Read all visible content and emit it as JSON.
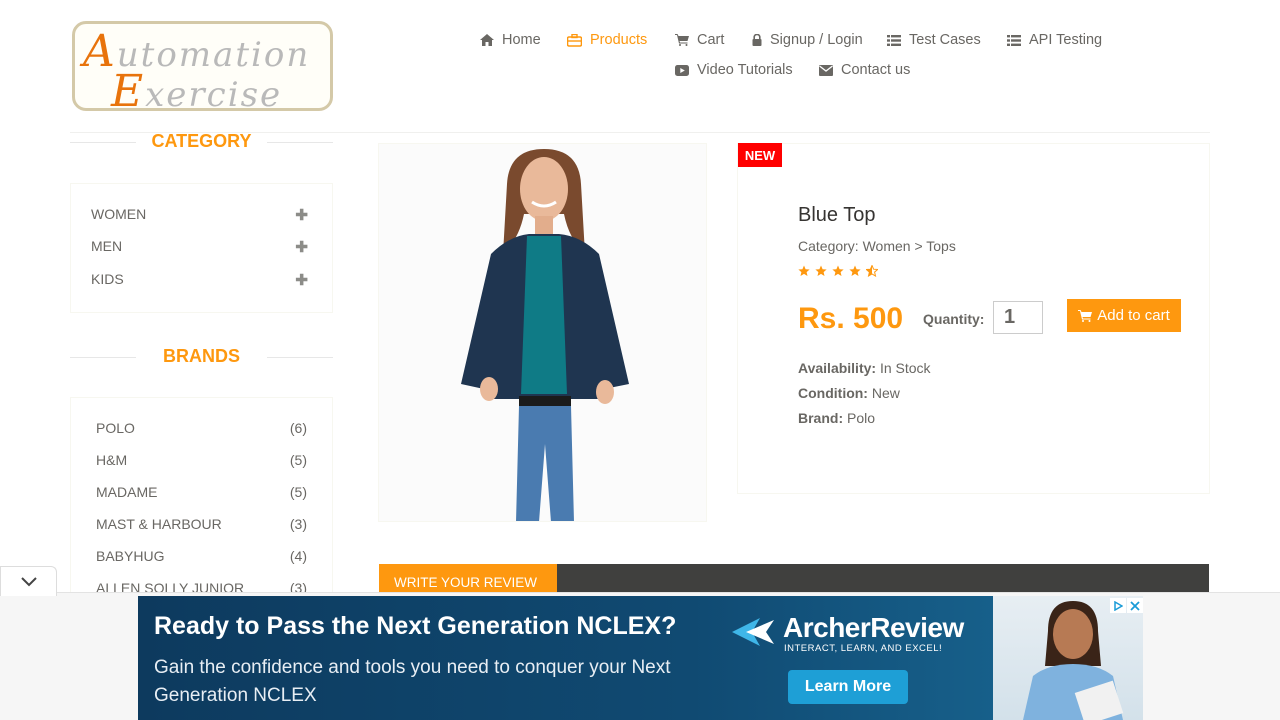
{
  "logo": {
    "line1_first": "A",
    "line1_rest": "utomation",
    "line2_first": "E",
    "line2_rest": "xercise"
  },
  "nav": {
    "home": {
      "label": "Home",
      "icon": "home-icon"
    },
    "products": {
      "label": "Products",
      "icon": "products-icon"
    },
    "cart": {
      "label": "Cart",
      "icon": "cart-icon"
    },
    "login": {
      "label": "Signup / Login",
      "icon": "lock-icon"
    },
    "test_cases": {
      "label": "Test Cases",
      "icon": "list-icon"
    },
    "api_testing": {
      "label": "API Testing",
      "icon": "list-icon"
    },
    "video": {
      "label": "Video Tutorials",
      "icon": "youtube-icon"
    },
    "contact": {
      "label": "Contact us",
      "icon": "envelope-icon"
    }
  },
  "sidebar": {
    "category_title": "CATEGORY",
    "categories": [
      {
        "label": "WOMEN"
      },
      {
        "label": "MEN"
      },
      {
        "label": "KIDS"
      }
    ],
    "brands_title": "BRANDS",
    "brands": [
      {
        "label": "POLO",
        "count": "(6)"
      },
      {
        "label": "H&M",
        "count": "(5)"
      },
      {
        "label": "MADAME",
        "count": "(5)"
      },
      {
        "label": "MAST & HARBOUR",
        "count": "(3)"
      },
      {
        "label": "BABYHUG",
        "count": "(4)"
      },
      {
        "label": "ALLEN SOLLY JUNIOR",
        "count": "(3)"
      }
    ]
  },
  "product": {
    "badge": "NEW",
    "name": "Blue Top",
    "category": "Category: Women > Tops",
    "rating": 4.5,
    "price": "Rs. 500",
    "quantity_label": "Quantity:",
    "quantity_value": "1",
    "add_to_cart": "Add to cart",
    "availability_label": "Availability:",
    "availability": "In Stock",
    "condition_label": "Condition:",
    "condition": "New",
    "brand_label": "Brand:",
    "brand": "Polo"
  },
  "review": {
    "tab_label": "WRITE YOUR REVIEW"
  },
  "ad": {
    "headline": "Ready to Pass the Next Generation NCLEX?",
    "subline": "Gain the confidence and tools you need to conquer your Next Generation NCLEX",
    "brand": "ArcherReview",
    "tagline": "INTERACT, LEARN, AND EXCEL!",
    "cta": "Learn More"
  },
  "colors": {
    "accent": "#fe980f",
    "badge": "#ff0000",
    "text": "#696763",
    "review_bar": "#40403e"
  }
}
